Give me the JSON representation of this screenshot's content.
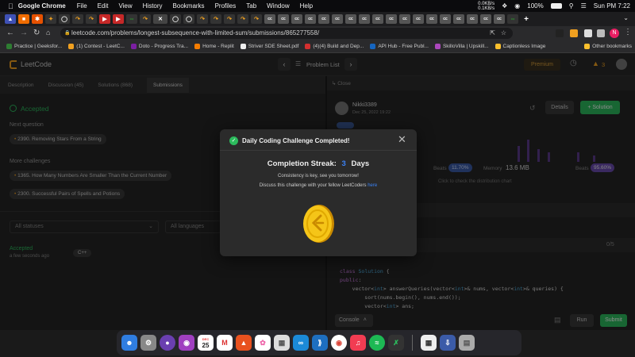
{
  "mac": {
    "app": "Google Chrome",
    "menus": [
      "File",
      "Edit",
      "View",
      "History",
      "Bookmarks",
      "Profiles",
      "Tab",
      "Window",
      "Help"
    ],
    "net_up": "0.0KB/s",
    "net_down": "0.1KB/s",
    "battery": "100%",
    "clock": "Sun PM 7:22"
  },
  "browser": {
    "url": "leetcode.com/problems/longest-subsequence-with-limited-sum/submissions/865277558/",
    "bookmarks": [
      "Practice | Geeksfor...",
      "(1) Contest - LeetC...",
      "Doto - Progress Tra...",
      "Home - Replit",
      "Striver SDE Sheet.pdf",
      "(4)(4) Build and Dep...",
      "API Hub - Free Publ...",
      "SkilloVilla | Upskill...",
      "Captionless Image",
      "Other bookmarks"
    ]
  },
  "lc": {
    "logo": "LeetCode",
    "problem_list": "Problem List",
    "premium": "Premium",
    "streak": "3",
    "tabs": [
      "Description",
      "Discussion (45)",
      "Solutions (868)",
      "Submissions"
    ],
    "accepted": "Accepted",
    "next_question_label": "Next question",
    "next_question": "2390. Removing Stars From a String",
    "more_challenges_label": "More challenges",
    "challenge1": "1365. How Many Numbers Are Smaller Than the Current Number",
    "challenge2": "2300. Successful Pairs of Spells and Potions",
    "all_statuses": "All statuses",
    "all_languages": "All languages",
    "row_status": "Accepted",
    "row_time": "a few seconds ago",
    "row_lang": "C++",
    "close": "Close",
    "username": "Nikki3389",
    "date": "Dec 25, 2022 19:22",
    "details": "Details",
    "solution": "Solution",
    "beats1_label": "Beats",
    "beats1": "11.70%",
    "memory_label": "Memory",
    "memory": "13.6 MB",
    "beats2_label": "Beats",
    "beats2": "95.60%",
    "dist_hint": "Click to check the distribution chart",
    "count": "0/5",
    "console": "Console",
    "run": "Run",
    "submit": "Submit"
  },
  "modal": {
    "title": "Daily Coding Challenge Completed!",
    "streak_label": "Completion Streak:",
    "streak_value": "3",
    "streak_unit": "Days",
    "line1": "Consistency is key, see you tomorrow!",
    "line2": "Discuss this challenge with your fellow LeetCoders",
    "here": "here"
  },
  "code": [
    "class Solution {",
    "public:",
    "    vector<int> answerQueries(vector<int>& nums, vector<int>& queries) {",
    "        sort(nums.begin(), nums.end());",
    "        vector<int> ans;"
  ],
  "dock": {
    "calendar_month": "DEC",
    "calendar_day": "25"
  },
  "colors": {
    "accent": "#2cbb5d",
    "blue": "#3b82f6",
    "coin": "#f5c518"
  }
}
